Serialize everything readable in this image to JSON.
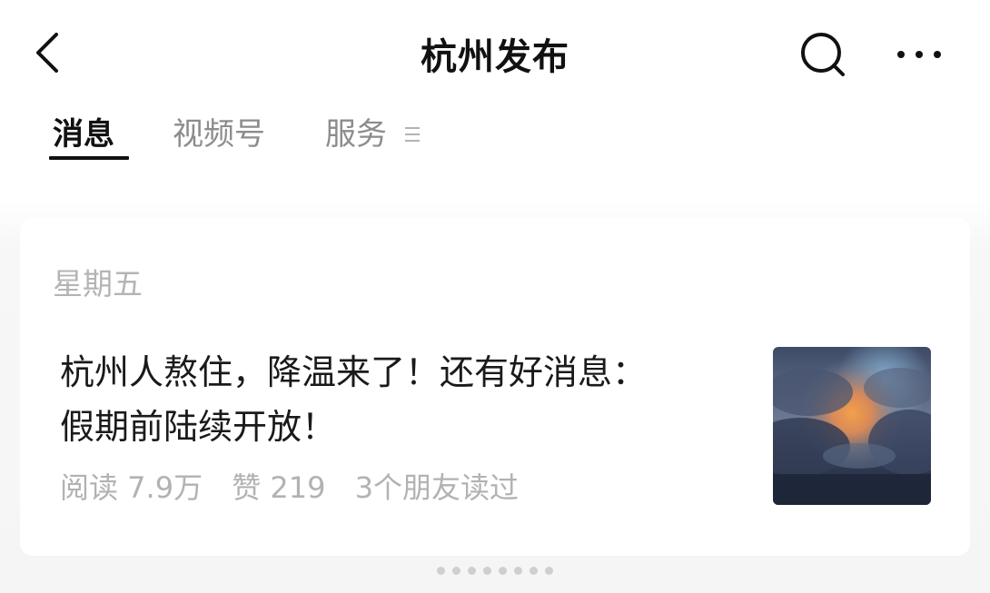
{
  "header": {
    "title": "杭州发布",
    "icons": {
      "back": "chevron-left-icon",
      "search": "search-icon",
      "more": "more-horizontal-icon"
    }
  },
  "tabs": [
    {
      "label": "消息",
      "active": true
    },
    {
      "label": "视频号",
      "active": false
    },
    {
      "label": "服务",
      "active": false
    }
  ],
  "feed": {
    "date_label": "星期五",
    "article": {
      "title_line1": "杭州人熬住，降温来了！还有好消息：",
      "title_line2": "假期前陆续开放！",
      "reads": "阅读 7.9万",
      "likes": "赞 219",
      "friends": "3个朋友读过",
      "thumbnail": "sunset-clouds-image"
    }
  },
  "colors": {
    "text_primary": "#111111",
    "text_secondary": "#8c8c8c",
    "meta_gray": "#b2b2b2",
    "background": "#f5f5f5"
  }
}
